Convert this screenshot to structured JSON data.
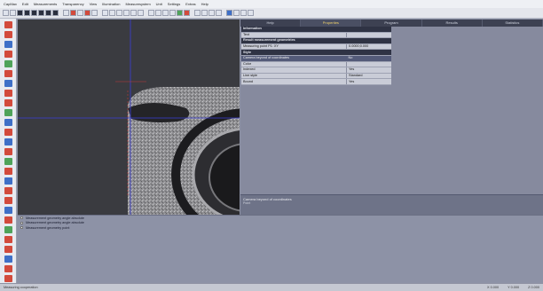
{
  "menu": [
    "CapMax",
    "Edit",
    "Measurements",
    "Transparency",
    "View",
    "Illumination",
    "Measuresystem",
    "Unit",
    "Settings",
    "Extras",
    "Help"
  ],
  "tabs": [
    "Help",
    "Properties",
    "Program",
    "Results",
    "Statistics"
  ],
  "properties": [
    {
      "kind": "section",
      "label": "Information",
      "value": ""
    },
    {
      "kind": "row",
      "label": "Text",
      "value": ""
    },
    {
      "kind": "section",
      "label": "Result measurement geometries",
      "value": ""
    },
    {
      "kind": "row",
      "label": "Measuring point P1: XY",
      "value": "0.0000;0.000"
    },
    {
      "kind": "section",
      "label": "Style",
      "value": ""
    },
    {
      "kind": "highlight",
      "label": "Camera beyond of coordinates",
      "value": "No"
    },
    {
      "kind": "row",
      "label": "Color",
      "value": ""
    },
    {
      "kind": "row",
      "label": "Indexed",
      "value": "Yes"
    },
    {
      "kind": "row",
      "label": "Line style",
      "value": "Standard"
    },
    {
      "kind": "row",
      "label": "Bound",
      "value": "Yes"
    }
  ],
  "description": {
    "title": "Camera beyond of coordinates",
    "subtitle": "Point"
  },
  "log": [
    "Measurement geometry angle absolute",
    "Measurement geometry angle absolute",
    "Measurement geometry point"
  ],
  "status": {
    "left": "Measuring cooperation",
    "right": [
      "X 0.000",
      "Y 0.000",
      "Z 0.000"
    ]
  }
}
